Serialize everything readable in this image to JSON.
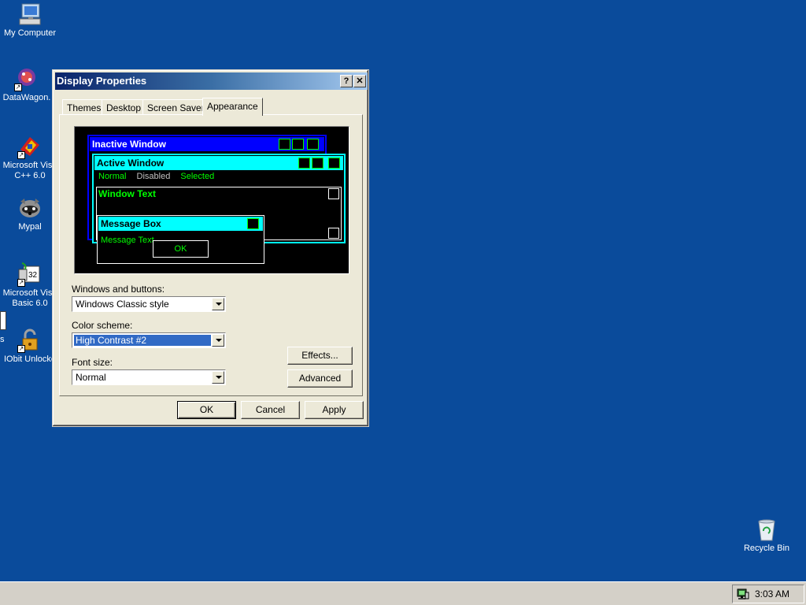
{
  "desktop": {
    "icons": [
      {
        "label": "My Computer",
        "icon": "computer-icon"
      },
      {
        "label": "DataWagon.",
        "icon": "datawagon-icon"
      },
      {
        "label": "Microsoft Visu",
        "label2": "C++ 6.0",
        "icon": "visual-cpp-icon"
      },
      {
        "label": "Mypal",
        "icon": "mypal-icon"
      },
      {
        "label": "Microsoft Visu",
        "label2": "Basic 6.0",
        "icon": "visual-basic-icon"
      },
      {
        "label": "IObit Unlocke",
        "icon": "iobit-unlocker-icon"
      },
      {
        "label": "Recycle Bin",
        "icon": "recycle-bin-icon"
      }
    ],
    "partial_label": "s"
  },
  "dialog": {
    "title": "Display Properties",
    "help_glyph": "?",
    "close_glyph": "✕",
    "tabs": [
      {
        "label": "Themes",
        "active": false
      },
      {
        "label": "Desktop",
        "active": false
      },
      {
        "label": "Screen Saver",
        "active": false
      },
      {
        "label": "Appearance",
        "active": true
      }
    ],
    "preview": {
      "inactive_window": "Inactive Window",
      "active_window": "Active Window",
      "menu_normal": "Normal",
      "menu_disabled": "Disabled",
      "menu_selected": "Selected",
      "window_text": "Window Text",
      "message_box": "Message Box",
      "message_text": "Message Text",
      "ok_label": "OK"
    },
    "windows_buttons_label": "Windows and buttons:",
    "windows_buttons_value": "Windows Classic style",
    "color_scheme_label": "Color scheme:",
    "color_scheme_value": "High Contrast #2",
    "font_size_label": "Font size:",
    "font_size_value": "Normal",
    "effects_button": "Effects...",
    "advanced_button": "Advanced",
    "ok_button": "OK",
    "cancel_button": "Cancel",
    "apply_button": "Apply"
  },
  "taskbar": {
    "clock": "3:03 AM",
    "tray_icon": "network-monitor-icon"
  },
  "colors": {
    "desktop": "#0a4b9b",
    "scheme_cyan": "#00ffff",
    "scheme_green": "#00ff00",
    "scheme_blue": "#0000ff",
    "selection": "#316ac5"
  }
}
